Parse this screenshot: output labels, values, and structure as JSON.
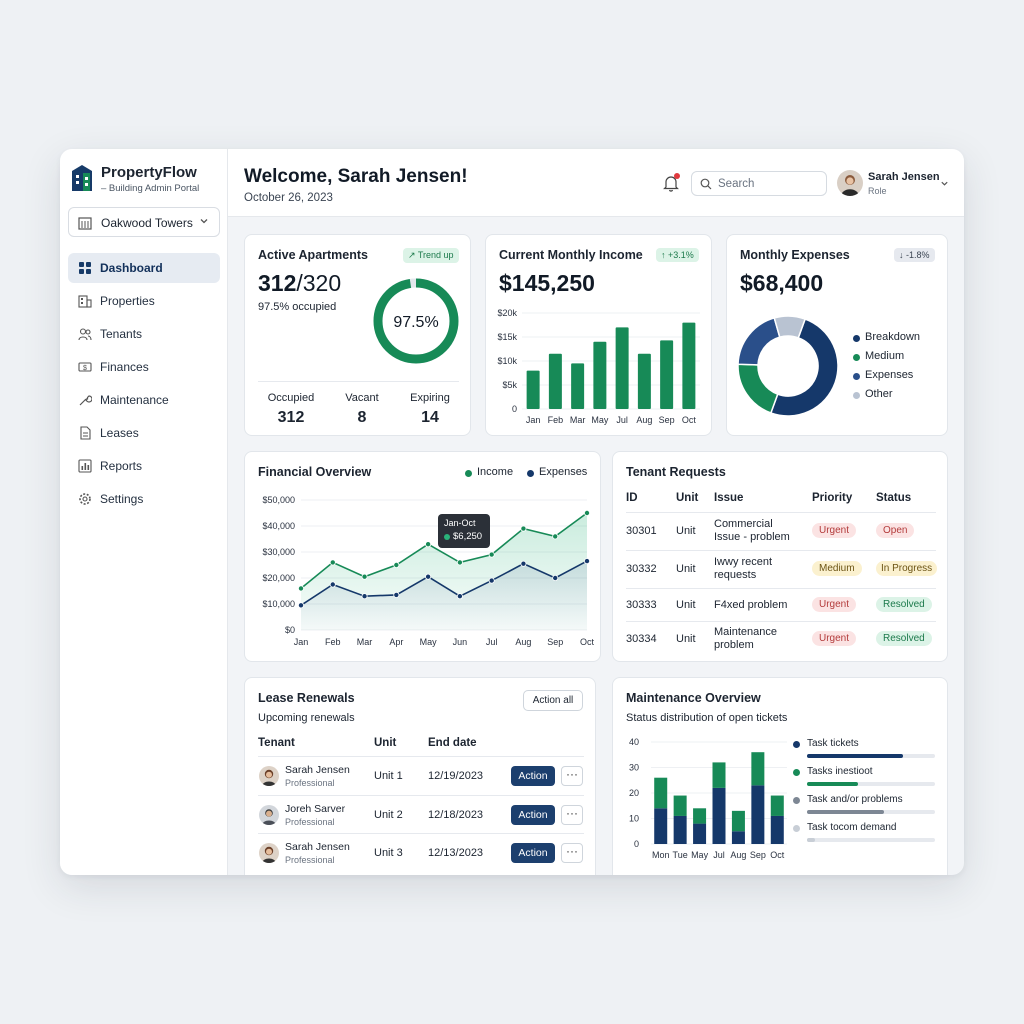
{
  "brand": {
    "name": "PropertyFlow",
    "subtitle": "– Building Admin Portal"
  },
  "property_select": {
    "value": "Oakwood Towers"
  },
  "nav": [
    {
      "label": "Dashboard",
      "icon": "dashboard-icon",
      "active": true
    },
    {
      "label": "Properties",
      "icon": "properties-icon"
    },
    {
      "label": "Tenants",
      "icon": "tenants-icon"
    },
    {
      "label": "Finances",
      "icon": "finances-icon"
    },
    {
      "label": "Maintenance",
      "icon": "wrench-icon"
    },
    {
      "label": "Leases",
      "icon": "document-icon"
    },
    {
      "label": "Reports",
      "icon": "reports-icon"
    },
    {
      "label": "Settings",
      "icon": "gear-icon"
    }
  ],
  "header": {
    "welcome": "Welcome, Sarah Jensen!",
    "date": "October 26, 2023",
    "search_placeholder": "Search",
    "user_name": "Sarah Jensen",
    "user_role": "Role"
  },
  "colors": {
    "green": "#178a57",
    "navy": "#15386a",
    "gray": "#b9c3d2"
  },
  "apartments": {
    "title": "Active Apartments",
    "badge": "↗ Trend up",
    "value_main": "312",
    "value_total": "/320",
    "sub": "97.5% occupied",
    "donut_label": "97.5%",
    "occupancy": 0.975,
    "stats": [
      {
        "label": "Occupied",
        "value": "312"
      },
      {
        "label": "Vacant",
        "value": "8"
      },
      {
        "label": "Expiring",
        "value": "14"
      }
    ]
  },
  "income": {
    "title": "Current Monthly Income",
    "badge": "↑ +3.1%",
    "value": "$145,250",
    "chart_data": {
      "type": "bar",
      "categories": [
        "Jan",
        "Feb",
        "Mar",
        "May",
        "Jul",
        "Aug",
        "Sep",
        "Oct"
      ],
      "values": [
        8000,
        11500,
        9500,
        14000,
        17000,
        11500,
        14300,
        18000
      ],
      "ylim": [
        0,
        20000
      ],
      "yticks": [
        "0",
        "$5k",
        "$10k",
        "$15k",
        "$20k"
      ]
    }
  },
  "expenses": {
    "title": "Monthly Expenses",
    "badge": "↓ -1.8%",
    "value": "$68,400",
    "chart_data": {
      "type": "pie",
      "slices": [
        {
          "name": "Breakdown",
          "value": 50,
          "color": "#15386a"
        },
        {
          "name": "Medium",
          "value": 20,
          "color": "#178a57"
        },
        {
          "name": "Expenses",
          "value": 20,
          "color": "#2a4f8a"
        },
        {
          "name": "Other",
          "value": 10,
          "color": "#b9c3d2"
        }
      ]
    }
  },
  "financial": {
    "title": "Financial Overview",
    "legend_income": "Income",
    "legend_expenses": "Expenses",
    "tooltip_title": "Jan-Oct",
    "tooltip_value": "$6,250",
    "chart_data": {
      "type": "line",
      "x": [
        "Jan",
        "Feb",
        "Mar",
        "Apr",
        "May",
        "Jun",
        "Jul",
        "Aug",
        "Sep",
        "Oct"
      ],
      "series": [
        {
          "name": "Income",
          "values": [
            16000,
            26000,
            20500,
            25000,
            33000,
            26000,
            29000,
            39000,
            36000,
            45000
          ]
        },
        {
          "name": "Expenses",
          "values": [
            9500,
            17500,
            13000,
            13500,
            20500,
            13000,
            19000,
            25500,
            20000,
            26500
          ]
        }
      ],
      "ylim": [
        0,
        50000
      ],
      "yticks": [
        "$0",
        "$10,000",
        "$20,000",
        "$30,000",
        "$40,000",
        "$50,000"
      ]
    }
  },
  "requests": {
    "title": "Tenant Requests",
    "headers": [
      "ID",
      "Unit",
      "Issue",
      "Priority",
      "Status"
    ],
    "rows": [
      {
        "id": "30301",
        "unit": "Unit",
        "issue": "Commercial Issue - problem",
        "priority": "Urgent",
        "status": "Open"
      },
      {
        "id": "30332",
        "unit": "Unit",
        "issue": "Iwwy recent requests",
        "priority": "Medium",
        "status": "In Progress"
      },
      {
        "id": "30333",
        "unit": "Unit",
        "issue": "F4xed problem",
        "priority": "Urgent",
        "status": "Resolved"
      },
      {
        "id": "30334",
        "unit": "Unit",
        "issue": "Maintenance problem",
        "priority": "Urgent",
        "status": "Resolved"
      }
    ]
  },
  "leases": {
    "title": "Lease Renewals",
    "subtitle": "Upcoming renewals",
    "action_all": "Action all",
    "headers": [
      "Tenant",
      "Unit",
      "End date"
    ],
    "rows": [
      {
        "name": "Sarah Jensen",
        "role": "Professional",
        "unit": "Unit 1",
        "end": "12/19/2023",
        "action": "Action",
        "more": "···"
      },
      {
        "name": "Joreh Sarver",
        "role": "Professional",
        "unit": "Unit 2",
        "end": "12/18/2023",
        "action": "Action",
        "more": "···"
      },
      {
        "name": "Sarah Jensen",
        "role": "Professional",
        "unit": "Unit 3",
        "end": "12/13/2023",
        "action": "Action",
        "more": "···"
      }
    ]
  },
  "maintenance": {
    "title": "Maintenance Overview",
    "subtitle": "Status distribution of open tickets",
    "chart_data": {
      "type": "bar",
      "categories": [
        "Mon",
        "Tue",
        "May",
        "Jul",
        "Aug",
        "Sep",
        "Oct"
      ],
      "series": [
        {
          "name": "navy",
          "values": [
            14,
            11,
            8,
            22,
            5,
            23,
            11
          ]
        },
        {
          "name": "green",
          "values": [
            12,
            8,
            6,
            10,
            8,
            13,
            8
          ]
        }
      ],
      "ylim": [
        0,
        40
      ],
      "yticks": [
        "0",
        "10",
        "20",
        "30",
        "40"
      ]
    },
    "legend": [
      {
        "label": "Task tickets",
        "color": "#15386a",
        "fill": 0.75
      },
      {
        "label": "Tasks inestioot",
        "color": "#178a57",
        "fill": 0.4
      },
      {
        "label": "Task and/or problems",
        "color": "#7d8794",
        "fill": 0.6
      },
      {
        "label": "Task tocom demand",
        "color": "#c8ced6",
        "fill": 0.06
      }
    ]
  }
}
